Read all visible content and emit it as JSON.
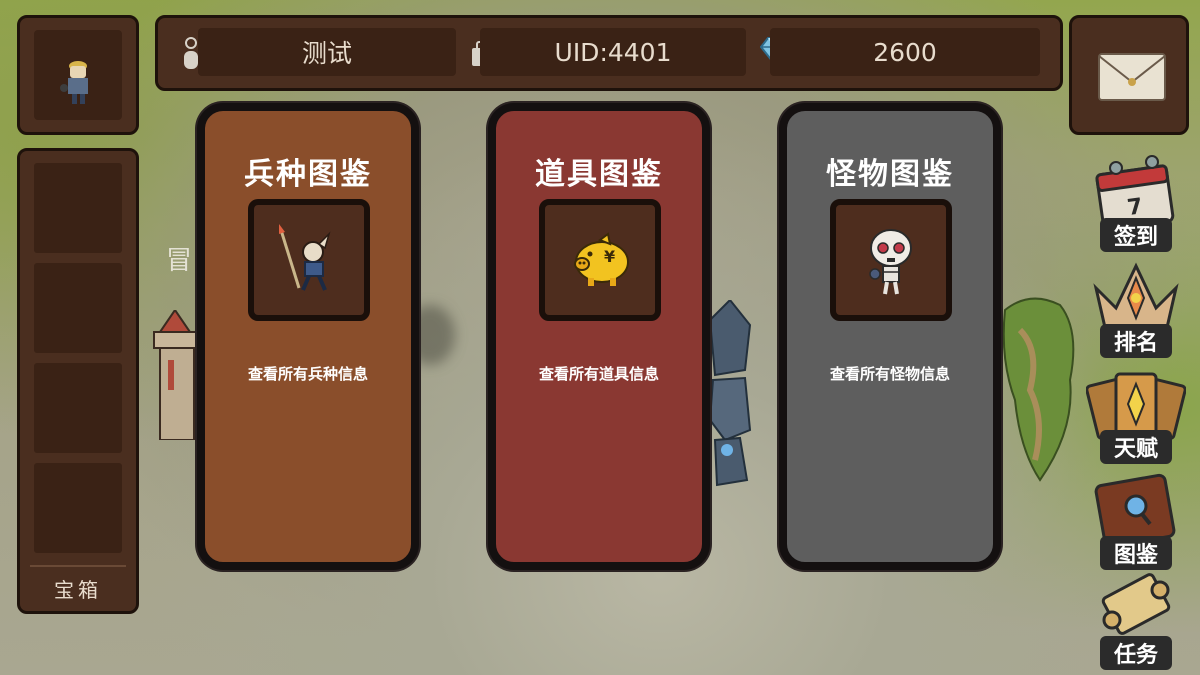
{
  "topbar": {
    "player_name": "测试",
    "uid": "UID:4401",
    "gems": "2600"
  },
  "sidebar": {
    "chest_label": "宝箱"
  },
  "background": {
    "partial_label": "冒"
  },
  "cards": [
    {
      "title": "兵种图鉴",
      "description": "查看所有兵种信息",
      "color": "#8a4e2b",
      "icon": "spear-soldier-icon"
    },
    {
      "title": "道具图鉴",
      "description": "查看所有道具信息",
      "color": "#8a3832",
      "icon": "gold-pig-icon"
    },
    {
      "title": "怪物图鉴",
      "description": "查看所有怪物信息",
      "color": "#5e5e5e",
      "icon": "skeleton-icon"
    }
  ],
  "side_menu": [
    {
      "label": "签到",
      "icon": "calendar-icon",
      "calendar_day": "7"
    },
    {
      "label": "排名",
      "icon": "crown-icon"
    },
    {
      "label": "天赋",
      "icon": "talent-cards-icon"
    },
    {
      "label": "图鉴",
      "icon": "book-icon"
    },
    {
      "label": "任务",
      "icon": "scroll-icon"
    }
  ]
}
